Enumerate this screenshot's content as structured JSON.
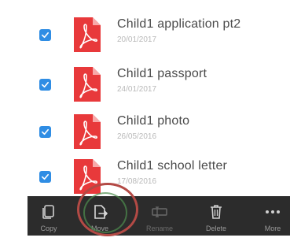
{
  "files": [
    {
      "name": "Child1 application pt2",
      "date": "20/01/2017",
      "checked": true,
      "icon": "pdf-icon"
    },
    {
      "name": "Child1 passport",
      "date": "24/01/2017",
      "checked": true,
      "icon": "pdf-icon"
    },
    {
      "name": "Child1 photo",
      "date": "26/05/2016",
      "checked": true,
      "icon": "pdf-icon"
    },
    {
      "name": "Child1 school letter",
      "date": "17/08/2016",
      "checked": true,
      "icon": "pdf-icon"
    }
  ],
  "toolbar": {
    "copy_label": "Copy",
    "move_label": "Move",
    "rename_label": "Rename",
    "delete_label": "Delete",
    "more_label": "More"
  },
  "colors": {
    "checkbox": "#2f8de4",
    "pdf": "#e8393b",
    "toolbar_bg": "#2c2c2c",
    "highlight_outer": "#b34a45",
    "highlight_inner": "#4f8f4f"
  }
}
